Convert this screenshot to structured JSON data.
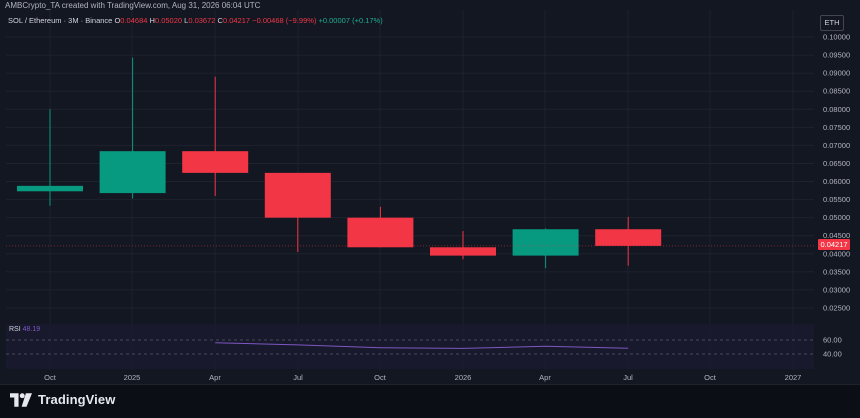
{
  "header": {
    "credit": "AMBCrypto_TA created with TradingView.com, Aug 31, 2026 06:04 UTC",
    "symbol_line": "SOL / Ethereum · 3M · Binance",
    "ohlc": {
      "o_label": "O",
      "o_value": "0.04684",
      "h_label": "H",
      "h_value": "0.05020",
      "l_label": "L",
      "l_value": "0.03672",
      "c_label": "C",
      "c_value": "0.04217",
      "change": "−0.00468 (−9.99%)",
      "extra": "+0.00007 (+0.17%)"
    }
  },
  "currency_badge": "ETH",
  "last_price_label": "0.04217",
  "rsi": {
    "name": "RSI",
    "value": "48.19",
    "levels": [
      "60.00",
      "40.00"
    ]
  },
  "logo": {
    "text": "TradingView"
  },
  "colors": {
    "up": "#089981",
    "down": "#f23645",
    "background": "#131722",
    "rsi_line": "#7e57c2"
  },
  "chart_data": {
    "type": "candlestick",
    "y_axis": {
      "ticks": [
        "0.10000",
        "0.09500",
        "0.09000",
        "0.08500",
        "0.08000",
        "0.07500",
        "0.07000",
        "0.06500",
        "0.06000",
        "0.05500",
        "0.05000",
        "0.04500",
        "0.04000",
        "0.03500",
        "0.03000",
        "0.02500"
      ],
      "scale": "linear"
    },
    "x_axis": {
      "ticks": [
        "Oct",
        "2025",
        "Apr",
        "Jul",
        "Oct",
        "2026",
        "Apr",
        "Jul",
        "Oct",
        "2027"
      ]
    },
    "candles": [
      {
        "period": "2024-Q3",
        "open": 0.0573,
        "high": 0.08,
        "low": 0.0533,
        "close": 0.0588
      },
      {
        "period": "2024-Q4",
        "open": 0.0568,
        "high": 0.0943,
        "low": 0.0553,
        "close": 0.0684
      },
      {
        "period": "2025-Q1",
        "open": 0.0684,
        "high": 0.089,
        "low": 0.056,
        "close": 0.0624
      },
      {
        "period": "2025-Q2",
        "open": 0.0624,
        "high": 0.0624,
        "low": 0.0405,
        "close": 0.05
      },
      {
        "period": "2025-Q3",
        "open": 0.05,
        "high": 0.053,
        "low": 0.0418,
        "close": 0.0418
      },
      {
        "period": "2025-Q4",
        "open": 0.0418,
        "high": 0.0463,
        "low": 0.0385,
        "close": 0.0395
      },
      {
        "period": "2026-Q1",
        "open": 0.0395,
        "high": 0.047,
        "low": 0.036,
        "close": 0.0468
      },
      {
        "period": "2026-Q2",
        "open": 0.0468,
        "high": 0.0502,
        "low": 0.0367,
        "close": 0.0422
      }
    ],
    "rsi_series": [
      {
        "period": "2025-Q1",
        "value": 56
      },
      {
        "period": "2025-Q2",
        "value": 53
      },
      {
        "period": "2025-Q3",
        "value": 49
      },
      {
        "period": "2025-Q4",
        "value": 48
      },
      {
        "period": "2026-Q1",
        "value": 51
      },
      {
        "period": "2026-Q2",
        "value": 48.19
      }
    ],
    "rsi_levels": [
      60,
      40
    ]
  }
}
